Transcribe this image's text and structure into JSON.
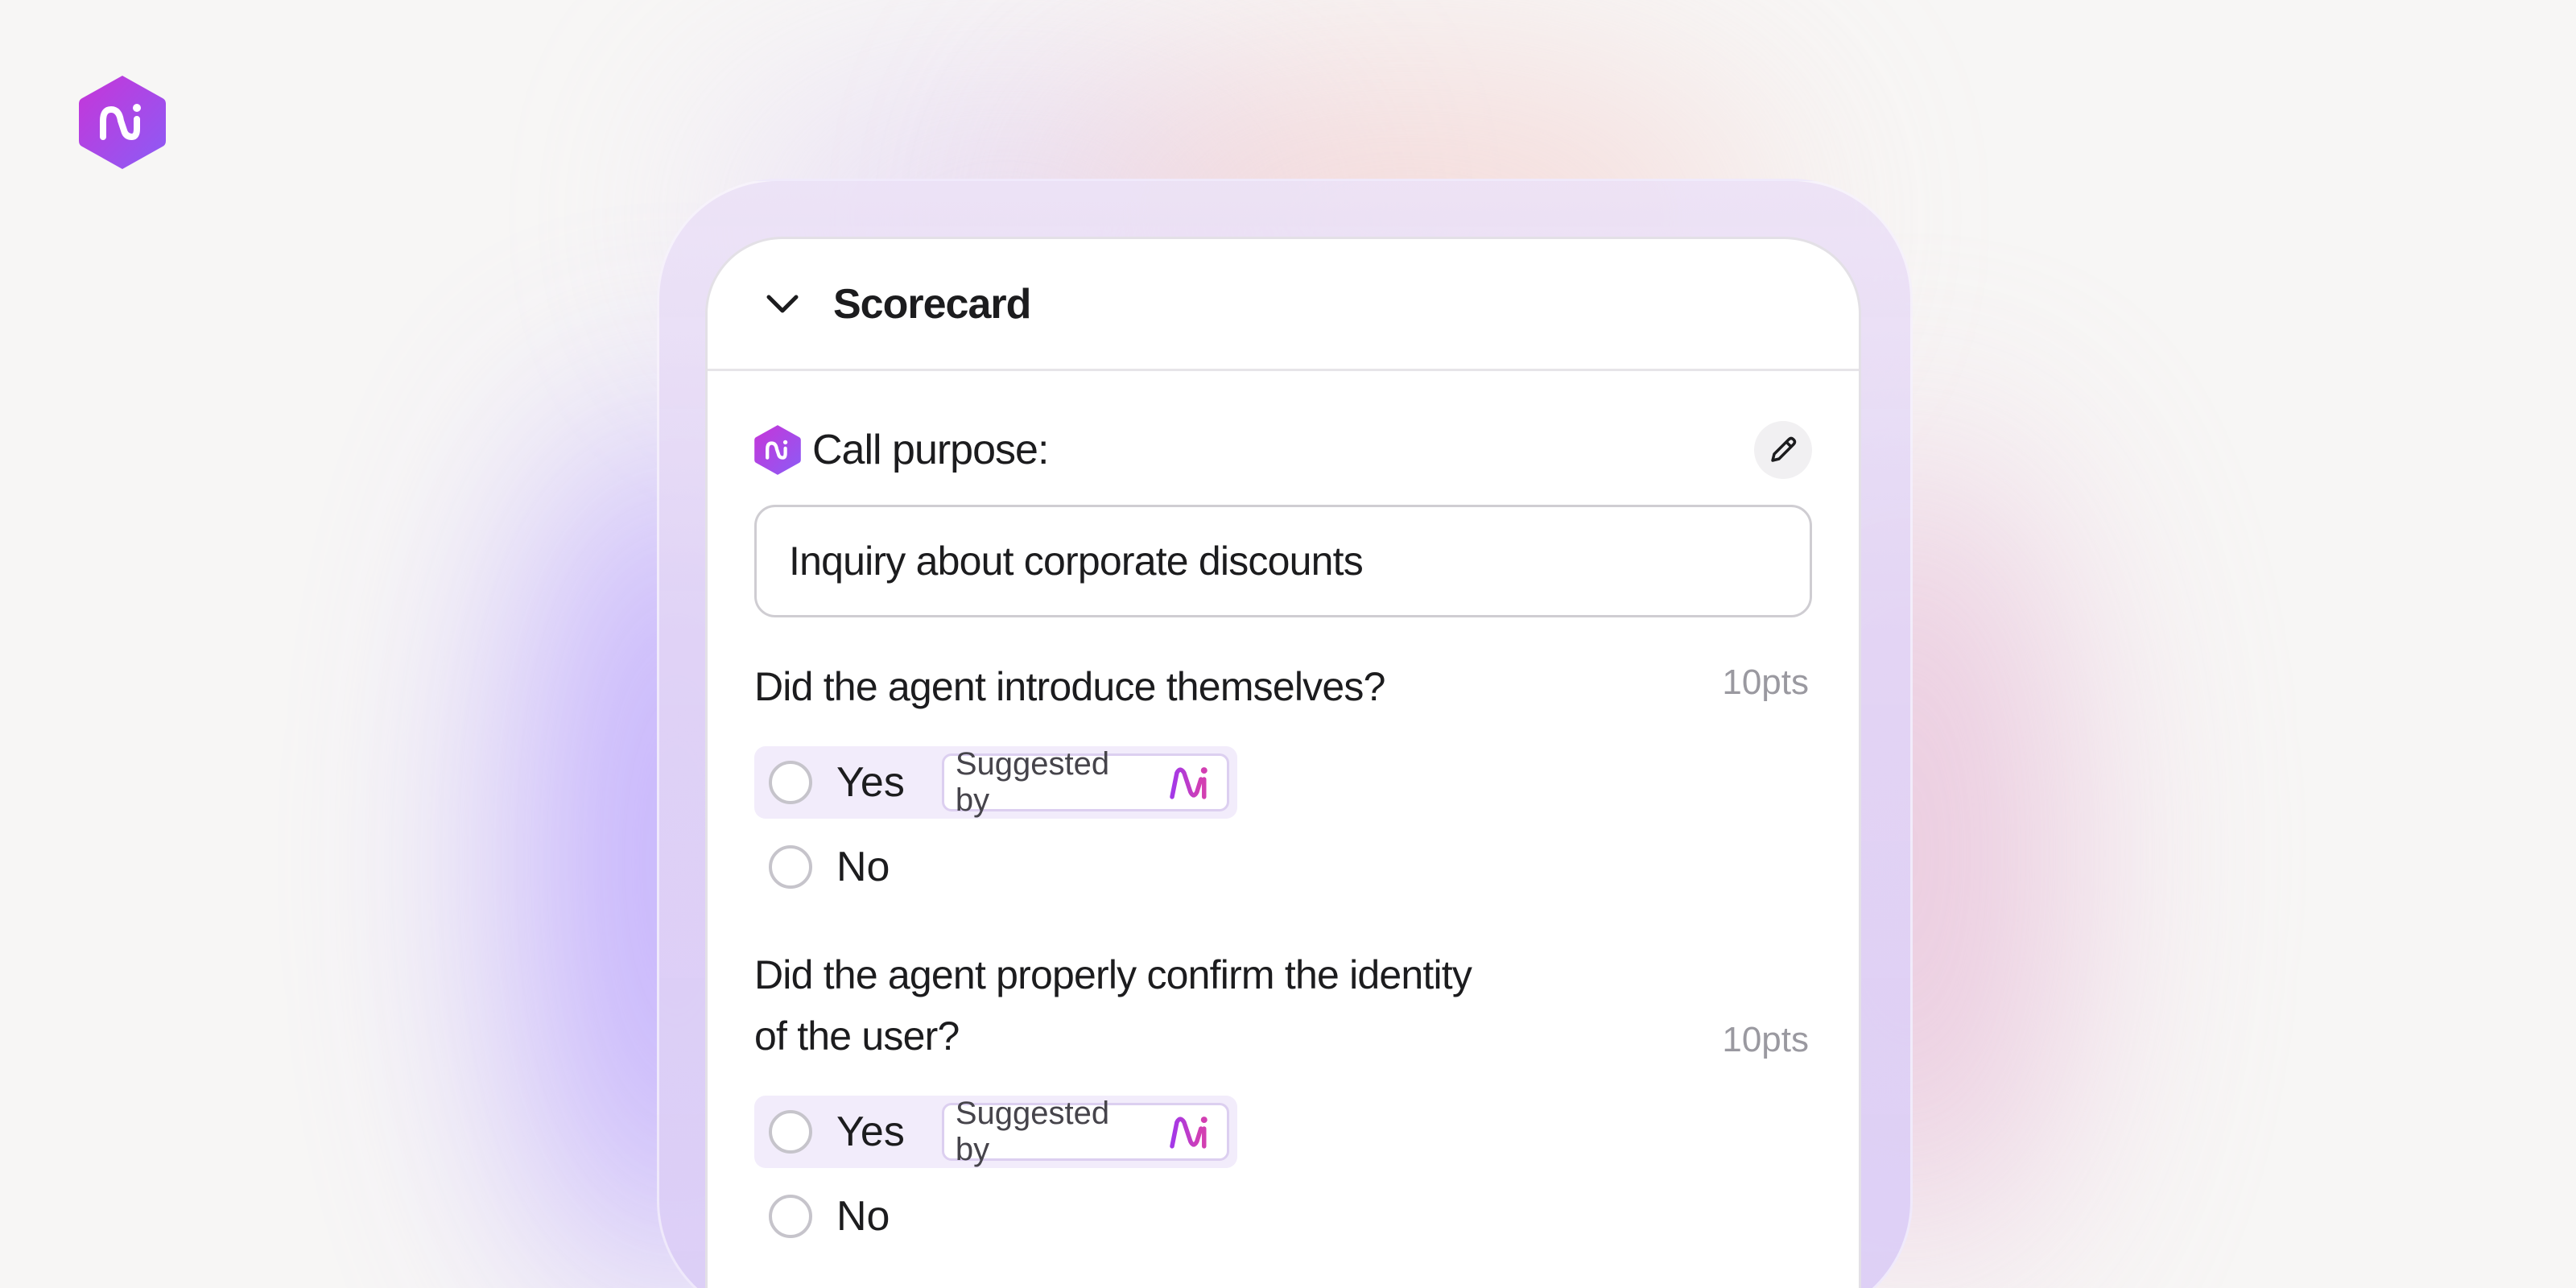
{
  "brand": {
    "logo_icon": "ni-logo-icon",
    "accent": "#a336e6",
    "accent2": "#7a5cff"
  },
  "scorecard": {
    "title": "Scorecard",
    "collapse_icon": "chevron-down-icon",
    "call_purpose": {
      "label": "Call purpose:",
      "value": "Inquiry about corporate discounts",
      "edit_icon": "pencil-icon"
    },
    "questions": [
      {
        "text": "Did the agent introduce themselves?",
        "points": "10pts",
        "options": [
          {
            "label": "Yes",
            "suggestion": "Suggested by"
          },
          {
            "label": "No"
          }
        ]
      },
      {
        "text_line1": "Did the agent properly confirm the identity",
        "text_line2": "of the user?",
        "points": "10pts",
        "options": [
          {
            "label": "Yes",
            "suggestion": "Suggested by"
          },
          {
            "label": "No"
          }
        ]
      }
    ]
  }
}
